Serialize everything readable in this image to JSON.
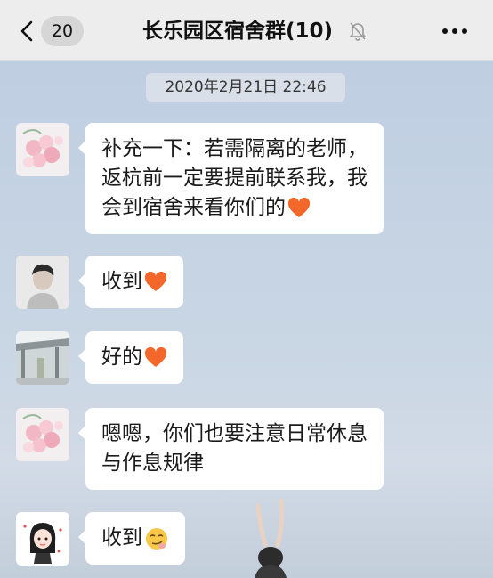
{
  "header": {
    "unread_count": "20",
    "title": "长乐园区宿舍群(10)",
    "icons": {
      "back": "chevron-left-icon",
      "mute": "bell-muted-icon",
      "more": "more-dots-icon"
    }
  },
  "timestamp": "2020年2月21日 22:46",
  "messages": [
    {
      "avatar": "avatar-flowers",
      "lines": [
        "补充一下：若需隔离的老师，",
        "返杭前一定要提前联系我，我",
        "会到宿舍来看你们的"
      ],
      "emoji": "heart-emoji"
    },
    {
      "avatar": "avatar-man-portrait",
      "lines": [
        "收到"
      ],
      "emoji": "heart-emoji"
    },
    {
      "avatar": "avatar-building-photo",
      "lines": [
        "好的"
      ],
      "emoji": "heart-emoji"
    },
    {
      "avatar": "avatar-flowers",
      "lines": [
        "嗯嗯，你们也要注意日常休息",
        "与作息规律"
      ],
      "emoji": ""
    },
    {
      "avatar": "avatar-cartoon-girl",
      "lines": [
        "收到"
      ],
      "emoji": "smirk-emoji"
    }
  ],
  "colors": {
    "header_bg": "#ededed",
    "bubble_bg": "#ffffff",
    "heart": "#f4672a"
  }
}
